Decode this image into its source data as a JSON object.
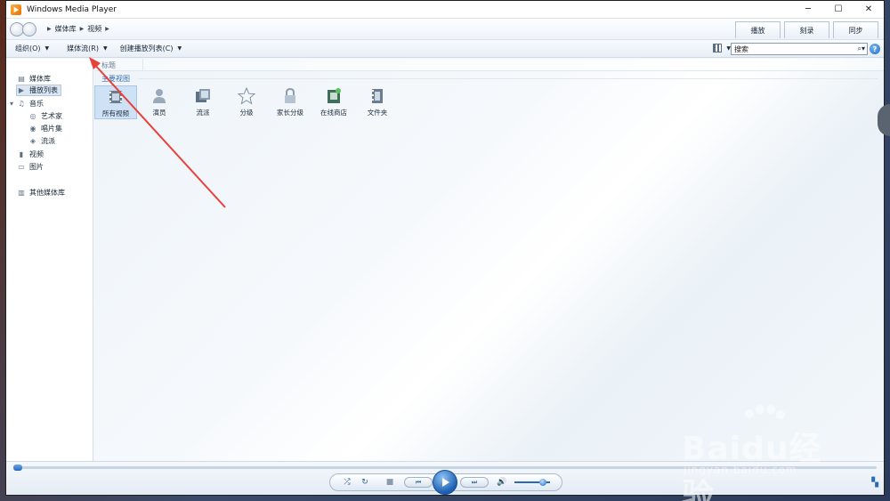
{
  "window": {
    "title": "Windows Media Player"
  },
  "nav": {
    "breadcrumb": [
      "媒体库",
      "视频"
    ]
  },
  "tabs": [
    "播放",
    "刻录",
    "同步"
  ],
  "toolbar": {
    "organize": "组织(O)",
    "stream": "媒体流(R)",
    "create_playlist": "创建播放列表(C)"
  },
  "search": {
    "placeholder": "搜索"
  },
  "sidebar": {
    "items": [
      {
        "label": "媒体库",
        "icon": "library-icon"
      },
      {
        "label": "播放列表",
        "icon": "playlist-icon",
        "selected": true
      },
      {
        "label": "音乐",
        "icon": "music-icon",
        "expanded": true
      },
      {
        "label": "艺术家",
        "icon": "artist-icon"
      },
      {
        "label": "唱片集",
        "icon": "album-icon"
      },
      {
        "label": "流派",
        "icon": "genre-icon"
      },
      {
        "label": "视频",
        "icon": "video-icon"
      },
      {
        "label": "图片",
        "icon": "picture-icon"
      },
      {
        "label": "其他媒体库",
        "icon": "other-libraries-icon"
      }
    ]
  },
  "content": {
    "column_header": "标题",
    "group_header": "主要视图",
    "tiles": [
      {
        "label": "所有视频",
        "icon": "all-videos-icon",
        "selected": true
      },
      {
        "label": "演员",
        "icon": "actor-icon"
      },
      {
        "label": "流派",
        "icon": "genre-icon"
      },
      {
        "label": "分级",
        "icon": "rating-star-icon"
      },
      {
        "label": "家长分级",
        "icon": "parental-rating-icon"
      },
      {
        "label": "在线商店",
        "icon": "online-store-icon"
      },
      {
        "label": "文件夹",
        "icon": "folder-icon"
      }
    ]
  },
  "player": {
    "volume_level": 0.8
  },
  "watermark": {
    "text": "Baidu经验",
    "url": "jingyan.baidu.com"
  },
  "colors": {
    "accent": "#2168c4",
    "annotation_arrow": "#e8403a",
    "selected_bg": "#cfe1f5"
  }
}
